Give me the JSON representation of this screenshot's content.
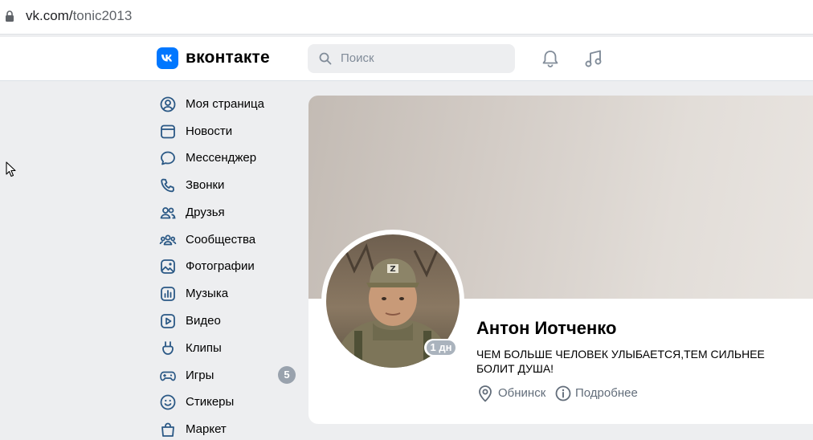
{
  "browser": {
    "url_host": "vk.com/",
    "url_path": "tonic2013"
  },
  "header": {
    "logo_text": "вконтакте",
    "search_placeholder": "Поиск",
    "icons": [
      "bell-icon",
      "music-icon"
    ]
  },
  "sidebar": {
    "items": [
      {
        "label": "Моя страница",
        "icon": "user-circle-icon"
      },
      {
        "label": "Новости",
        "icon": "news-icon"
      },
      {
        "label": "Мессенджер",
        "icon": "message-icon"
      },
      {
        "label": "Звонки",
        "icon": "phone-icon"
      },
      {
        "label": "Друзья",
        "icon": "friends-icon"
      },
      {
        "label": "Сообщества",
        "icon": "communities-icon"
      },
      {
        "label": "Фотографии",
        "icon": "photo-icon"
      },
      {
        "label": "Музыка",
        "icon": "music-library-icon"
      },
      {
        "label": "Видео",
        "icon": "video-icon"
      },
      {
        "label": "Клипы",
        "icon": "clips-icon"
      },
      {
        "label": "Игры",
        "icon": "gamepad-icon",
        "badge": "5"
      },
      {
        "label": "Стикеры",
        "icon": "smile-icon"
      },
      {
        "label": "Маркет",
        "icon": "bag-icon"
      }
    ]
  },
  "profile": {
    "name": "Антон Иотченко",
    "status": "ЧЕМ БОЛЬШЕ ЧЕЛОВЕК УЛЫБАЕТСЯ,ТЕМ СИЛЬНЕЕ БОЛИТ ДУША!",
    "last_seen": "1 дн",
    "city": "Обнинск",
    "details_link": "Подробнее"
  },
  "colors": {
    "accent": "#0077ff",
    "icon": "#2a5885",
    "page_bg": "#edeef0",
    "secondary_text": "#626d7a"
  }
}
